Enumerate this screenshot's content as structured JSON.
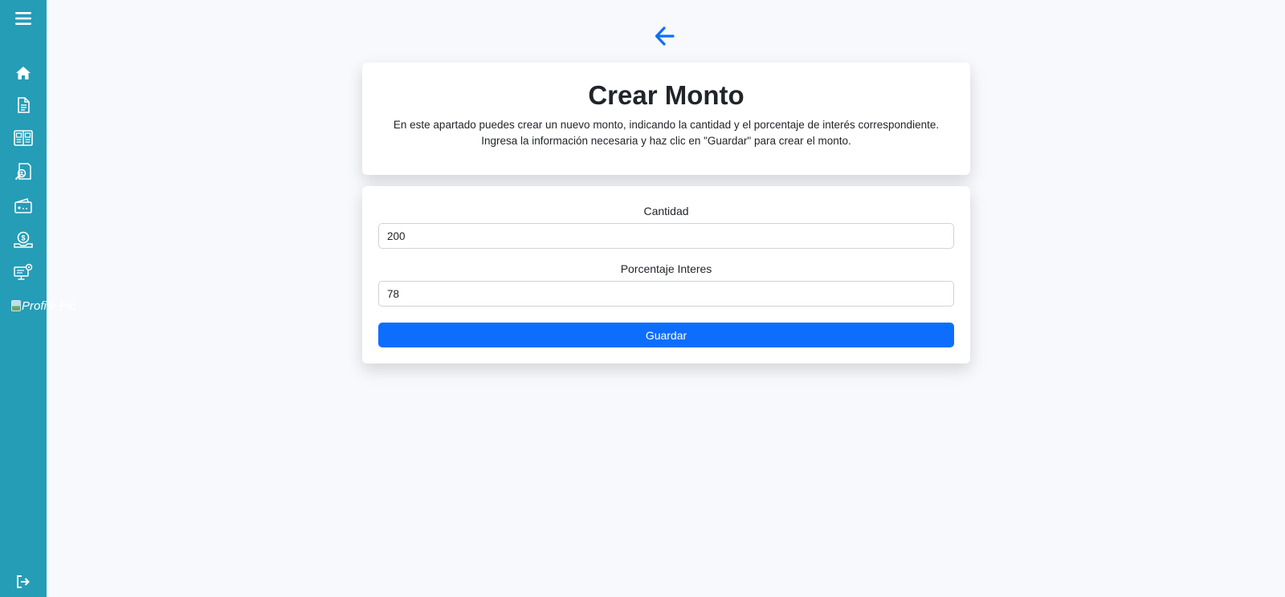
{
  "sidebar": {
    "icons": [
      "menu-icon",
      "home-icon",
      "document-icon",
      "catalog-icon",
      "search-document-icon",
      "wallet-icon",
      "payment-icon",
      "monitor-settings-icon"
    ],
    "profile_alt": "Profile Pic",
    "logout_icon": "logout-icon"
  },
  "header": {
    "back_icon": "arrow-left-icon",
    "title": "Crear Monto",
    "description": "En este apartado puedes crear un nuevo monto, indicando la cantidad y el porcentaje de interés correspondiente. Ingresa la información necesaria y haz clic en \"Guardar\" para crear el monto."
  },
  "form": {
    "cantidad_label": "Cantidad",
    "cantidad_value": "200",
    "porcentaje_label": "Porcentaje Interes",
    "porcentaje_value": "78",
    "save_label": "Guardar"
  },
  "colors": {
    "sidebar": "#259db6",
    "primary": "#0d6efd",
    "background": "#f8f9fc"
  }
}
